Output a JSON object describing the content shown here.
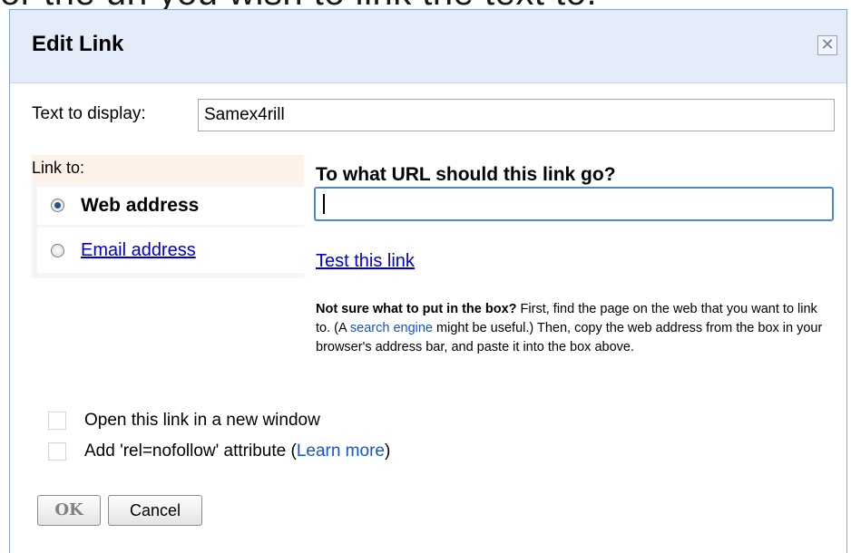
{
  "background": {
    "caption": "or the url you wish to link the text to."
  },
  "dialog": {
    "title": "Edit Link",
    "close_icon": "close-icon",
    "text_to_display_label": "Text to display:",
    "text_to_display_value": "Samex4rill",
    "link_to_label": "Link to:",
    "options": [
      {
        "label": "Web address",
        "selected": true
      },
      {
        "label": "Email address",
        "selected": false
      }
    ],
    "url_heading": "To what URL should this link go?",
    "url_value": "",
    "test_link": "Test this link",
    "help": {
      "lead": "Not sure what to put in the box?",
      "part1": " First, find the page on the web that you want to link to. (A ",
      "search_link": "search engine",
      "part2": " might be useful.) Then, copy the web address from the box in your browser's address bar, and paste it into the box above."
    },
    "checkboxes": [
      {
        "label": "Open this link in a new window",
        "checked": false
      },
      {
        "label_prefix": "Add 'rel=nofollow' attribute (",
        "link": "Learn more",
        "label_suffix": ")",
        "checked": false
      }
    ],
    "ok_label": "OK",
    "cancel_label": "Cancel"
  },
  "colors": {
    "title_bg": "#e3ecf8",
    "link": "#0000cc",
    "focus_border": "#4c88c5"
  }
}
